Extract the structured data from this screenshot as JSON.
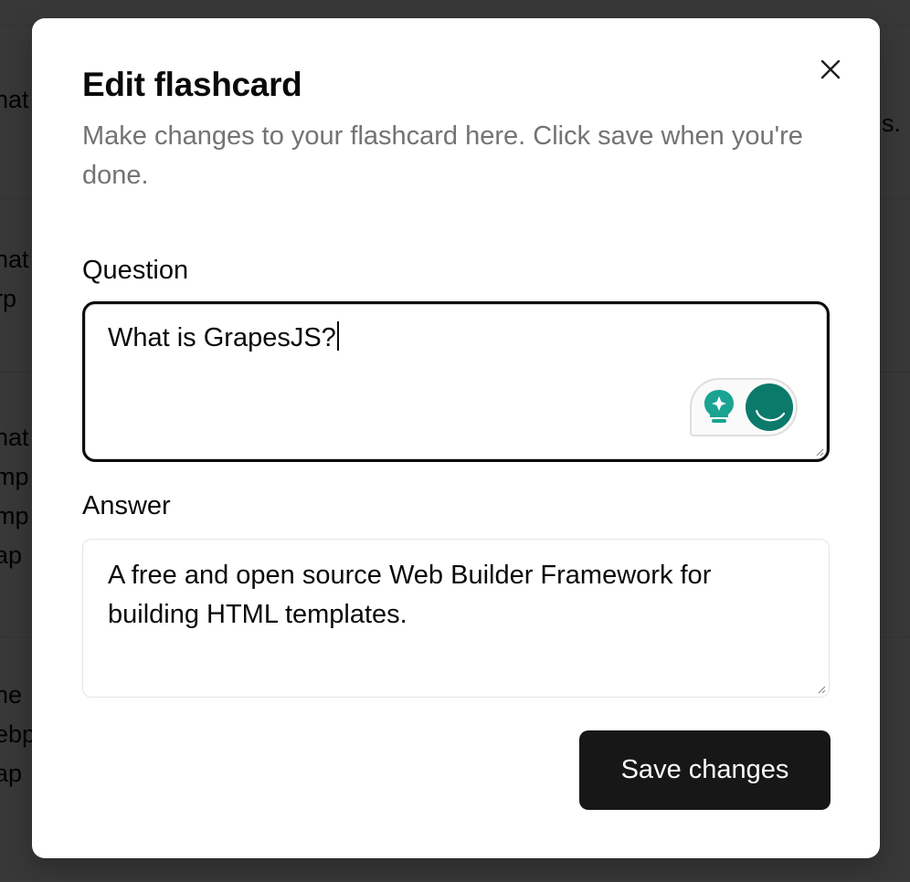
{
  "background": {
    "rows": [
      {
        "left_text": "hat",
        "right_text": "s."
      },
      {
        "left_text": "hat"
      },
      {
        "left_text": "rp"
      },
      {
        "left_text": "hat"
      },
      {
        "left_text": "mp"
      },
      {
        "left_text": "mp"
      },
      {
        "left_text": "ap"
      },
      {
        "left_text": "he"
      },
      {
        "left_text": "ebp"
      },
      {
        "left_text": "ap"
      }
    ]
  },
  "dialog": {
    "title": "Edit flashcard",
    "description": "Make changes to your flashcard here. Click save when you're done.",
    "close_icon": "close-icon",
    "question": {
      "label": "Question",
      "value": "What is GrapesJS?"
    },
    "answer": {
      "label": "Answer",
      "value": "A free and open source Web Builder Framework for building HTML templates."
    },
    "assistant_icons": [
      "lightbulb-sparkle-icon",
      "grammar-assistant-icon"
    ],
    "save_label": "Save changes"
  },
  "colors": {
    "primary_button": "#171717",
    "assistant_accent": "#0b7a6b",
    "bulb_accent": "#1aa391",
    "muted_text": "#737373"
  }
}
